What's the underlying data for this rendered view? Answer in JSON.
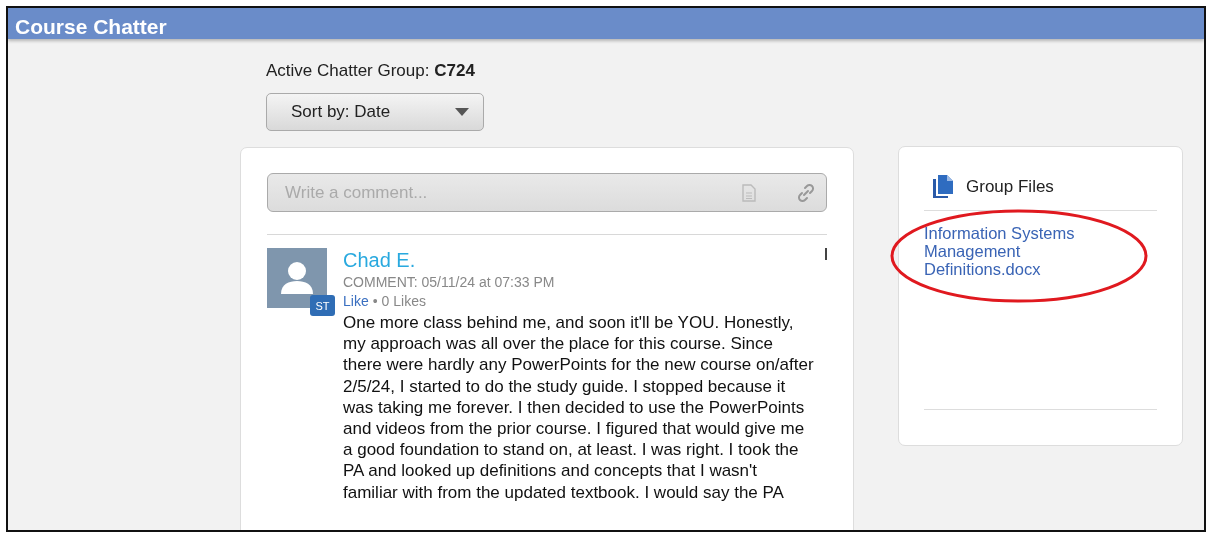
{
  "header": {
    "title": "Course Chatter"
  },
  "group": {
    "label": "Active Chatter Group:",
    "value": "C724"
  },
  "sort": {
    "label": "Sort by: Date"
  },
  "composer": {
    "placeholder": "Write a comment..."
  },
  "posts": [
    {
      "author": "Chad E.",
      "meta": "COMMENT: 05/11/24 at 07:33 PM",
      "badge": "ST",
      "like": "Like",
      "separator": "•",
      "likes": "0 Likes",
      "body": "One more class behind me, and soon it'll be YOU. Honestly, my approach was all over the place for this course. Since there were hardly any PowerPoints for the new course on/after 2/5/24, I started to do the study guide. I stopped because it was taking me forever. I then decided to use the PowerPoints and videos from the prior course. I figured that would give me a good foundation to stand on, at least. I was right. I took the PA and looked up definitions and concepts that I wasn't familiar with from the updated textbook. I would say the PA"
    }
  ],
  "files": {
    "title": "Group Files",
    "items": [
      {
        "name": "Information Systems Management Definitions.docx",
        "circled": true
      }
    ]
  }
}
